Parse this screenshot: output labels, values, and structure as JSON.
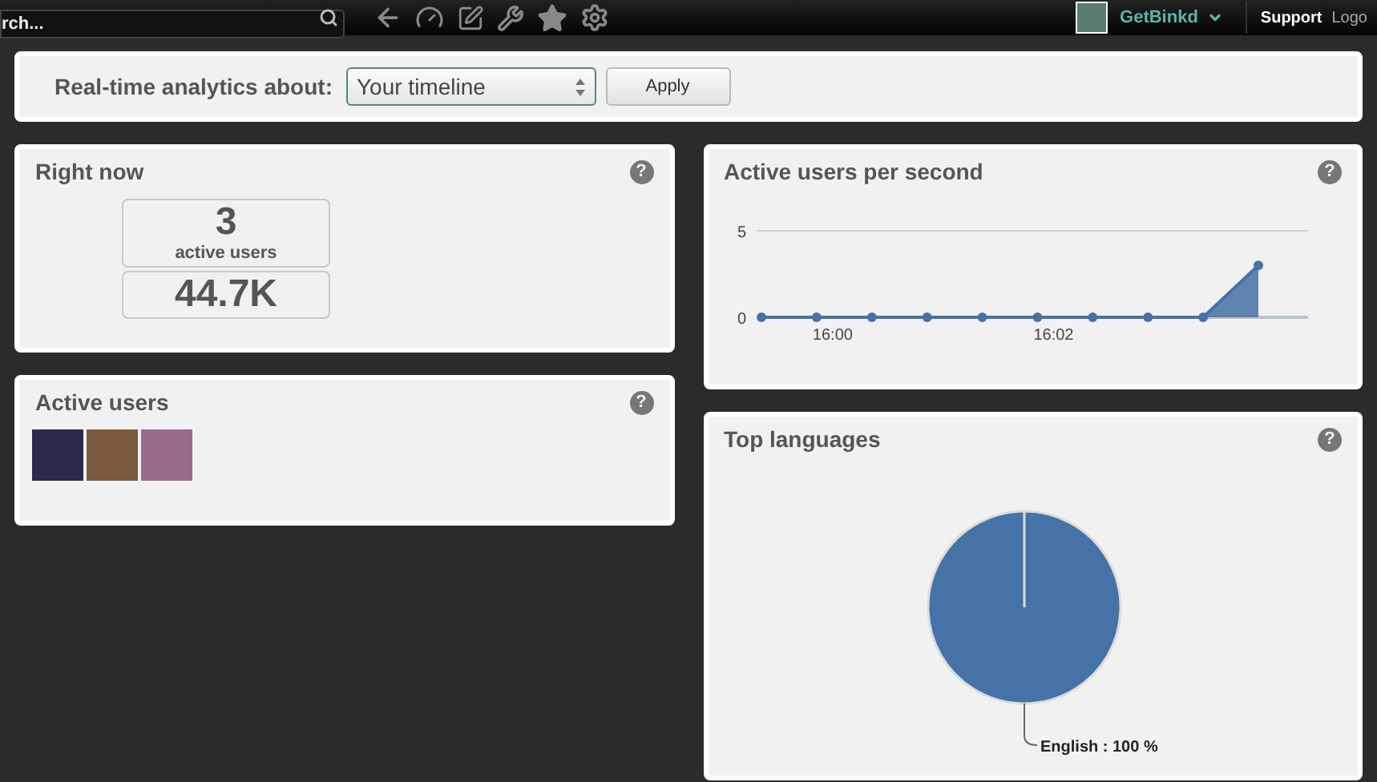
{
  "top_bar": {
    "search": {
      "placeholder": "rch..."
    },
    "user": {
      "name": "GetBinkd"
    },
    "links": [
      "Support",
      "Logo"
    ]
  },
  "filter": {
    "label": "Real-time analytics about:",
    "select": {
      "value": "Your timeline"
    },
    "button": "Apply"
  },
  "right_now": {
    "title": "Right now",
    "help": "?",
    "stats": [
      {
        "value": "3",
        "label": "active users"
      },
      {
        "value": "44.7K"
      }
    ]
  },
  "active_users": {
    "title": "Active users",
    "help": "?"
  },
  "per_second": {
    "title": "Active users per second",
    "help": "?",
    "chart_data": {
      "type": "area",
      "categories": [
        null,
        "16:00",
        null,
        null,
        null,
        "16:02",
        null,
        null,
        null,
        null
      ],
      "series": [
        {
          "color": "#4671a5",
          "values": [
            0,
            0,
            0,
            0,
            0,
            0,
            0,
            0,
            0,
            3
          ]
        }
      ],
      "ylim": [
        0,
        5
      ],
      "yticks": [
        0,
        5
      ]
    }
  },
  "languages": {
    "title": "Top languages",
    "help": "?",
    "chart_data": {
      "type": "pie",
      "series": [
        {
          "color": "#4572a7",
          "values": [
            100
          ]
        }
      ],
      "value_labels": [
        "English : 100 %"
      ]
    }
  }
}
